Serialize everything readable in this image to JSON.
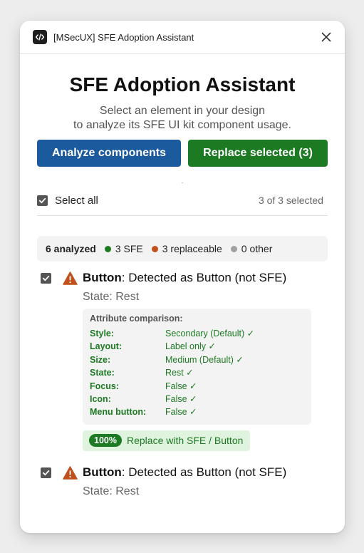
{
  "window": {
    "title": "[MSecUX] SFE Adoption Assistant"
  },
  "header": {
    "title": "SFE Adoption Assistant",
    "subtitle_line1": "Select an element in your design",
    "subtitle_line2": "to analyze its SFE UI kit component usage."
  },
  "actions": {
    "analyze_label": "Analyze components",
    "replace_label": "Replace selected (3)"
  },
  "separator": ".",
  "selection": {
    "select_all_label": "Select all",
    "selected_count": "3 of 3 selected"
  },
  "summary": {
    "analyzed": "6 analyzed",
    "sfe": "3 SFE",
    "replaceable": "3 replaceable",
    "other": "0 other"
  },
  "colors": {
    "sfe_dot": "#1c7a22",
    "replaceable_dot": "#c0501c",
    "other_dot": "#a0a0a0",
    "primary_blue": "#1c5a9e",
    "primary_green": "#1c7a22",
    "warning": "#c0501c"
  },
  "items": [
    {
      "name": "Button",
      "detection": ": Detected as Button (not SFE)",
      "state": "State: Rest",
      "comparison_title": "Attribute comparison:",
      "attributes": [
        {
          "key": "Style:",
          "value": "Secondary (Default) ✓"
        },
        {
          "key": "Layout:",
          "value": "Label only ✓"
        },
        {
          "key": "Size:",
          "value": "Medium (Default) ✓"
        },
        {
          "key": "State:",
          "value": "Rest ✓"
        },
        {
          "key": "Focus:",
          "value": "False ✓"
        },
        {
          "key": "Icon:",
          "value": "False ✓"
        },
        {
          "key": "Menu button:",
          "value": "False ✓"
        }
      ],
      "match_percent": "100%",
      "replace_label": "Replace with SFE / Button"
    },
    {
      "name": "Button",
      "detection": ": Detected as Button (not SFE)",
      "state": "State: Rest"
    }
  ],
  "icons": {
    "app": "code-icon",
    "close": "close-icon",
    "check": "checkmark-icon",
    "warning": "warning-icon"
  }
}
